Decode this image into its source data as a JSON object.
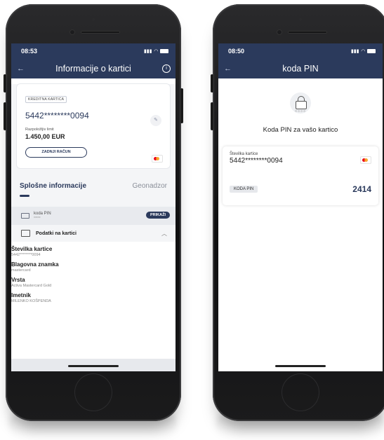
{
  "left_phone": {
    "status_time": "08:53",
    "nav_title": "Informacije o kartici",
    "card": {
      "type_label": "KREDITNA KARTICA",
      "number": "5442********0094",
      "limit_label": "Razpoložljiv limit",
      "limit_value": "1.450,00 EUR",
      "last_bill_button": "ZADNJI RAČUN"
    },
    "tabs": [
      "Splošne informacije",
      "Geonadzor"
    ],
    "pin": {
      "label": "koda PIN",
      "masked": "*****",
      "show_button": "PRIKAŽI"
    },
    "section_title": "Podatki na kartici",
    "info": [
      {
        "label": "Številka kartice",
        "value": "5442********0094"
      },
      {
        "label": "Blagovna znamka",
        "value": "mastercard"
      },
      {
        "label": "Vrsta",
        "value": "Activa Mastercard Gold"
      },
      {
        "label": "Imetnik",
        "value": "MILENKO KOŠPENDA"
      }
    ]
  },
  "right_phone": {
    "status_time": "08:50",
    "nav_title": "koda PIN",
    "lock_dots": "○○○○",
    "heading": "Koda PIN za vašo kartico",
    "card_label": "Številka kartice",
    "card_number": "5442********0094",
    "pin_badge": "KODA PIN",
    "pin_value": "2414"
  },
  "colors": {
    "brand": "#2b3a5c",
    "mastercard_red": "#eb001b",
    "mastercard_orange": "#f79e1b"
  }
}
